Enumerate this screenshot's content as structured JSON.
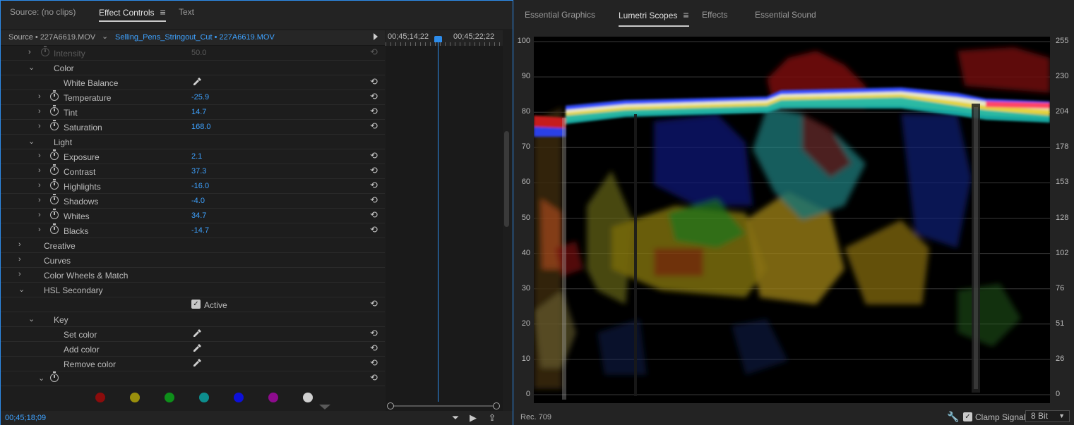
{
  "left_panel": {
    "tabs": [
      {
        "label": "Source: (no clips)"
      },
      {
        "label": "Effect Controls"
      },
      {
        "label": "Text"
      }
    ],
    "source_clip": "Source • 227A6619.MOV",
    "sequence_clip": "Selling_Pens_Stringout_Cut • 227A6619.MOV",
    "timecode_start": "00;45;14;22",
    "timecode_end": "00;45;22;22",
    "current_timecode": "00;45;18;09",
    "rows": [
      {
        "label": "Intensity",
        "value": "50.0"
      },
      {
        "label": "Color"
      },
      {
        "label": "White Balance"
      },
      {
        "label": "Temperature",
        "value": "-25.9"
      },
      {
        "label": "Tint",
        "value": "14.7"
      },
      {
        "label": "Saturation",
        "value": "168.0"
      },
      {
        "label": "Light"
      },
      {
        "label": "Exposure",
        "value": "2.1"
      },
      {
        "label": "Contrast",
        "value": "37.3"
      },
      {
        "label": "Highlights",
        "value": "-16.0"
      },
      {
        "label": "Shadows",
        "value": "-4.0"
      },
      {
        "label": "Whites",
        "value": "34.7"
      },
      {
        "label": "Blacks",
        "value": "-14.7"
      },
      {
        "label": "Creative"
      },
      {
        "label": "Curves"
      },
      {
        "label": "Color Wheels & Match"
      },
      {
        "label": "HSL Secondary"
      },
      {
        "label": "Active"
      },
      {
        "label": "Key"
      },
      {
        "label": "Set color"
      },
      {
        "label": "Add color"
      },
      {
        "label": "Remove color"
      }
    ],
    "swatches": [
      "#8b0c0c",
      "#9a8f0c",
      "#0e8f1a",
      "#0d8e8e",
      "#0d10d9",
      "#8d0b8d",
      "#d0d0d0"
    ]
  },
  "right_panel": {
    "tabs": [
      {
        "label": "Essential Graphics"
      },
      {
        "label": "Lumetri Scopes"
      },
      {
        "label": "Effects"
      },
      {
        "label": "Essential Sound"
      }
    ],
    "left_axis": [
      "100",
      "90",
      "80",
      "70",
      "60",
      "50",
      "40",
      "30",
      "20",
      "10",
      "0"
    ],
    "right_axis": [
      "255",
      "230",
      "204",
      "178",
      "153",
      "128",
      "102",
      "76",
      "51",
      "26",
      "0"
    ],
    "standard": "Rec. 709",
    "clamp_signal_label": "Clamp Signal",
    "bit_depth": "8 Bit"
  }
}
